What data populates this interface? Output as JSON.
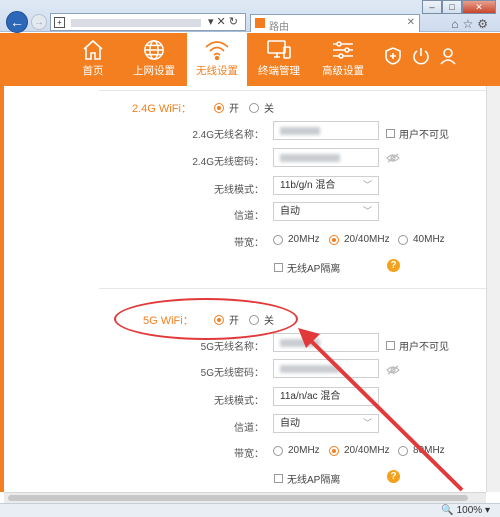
{
  "browser": {
    "tab_title": "路由",
    "zoom": "100%"
  },
  "nav": {
    "items": [
      {
        "label": "首页",
        "icon": "home-icon"
      },
      {
        "label": "上网设置",
        "icon": "globe-icon"
      },
      {
        "label": "无线设置",
        "icon": "wifi-icon"
      },
      {
        "label": "终端管理",
        "icon": "devices-icon"
      },
      {
        "label": "高级设置",
        "icon": "sliders-icon"
      }
    ],
    "active_index": 2
  },
  "wifi24": {
    "title": "2.4G WiFi：",
    "on_label": "开",
    "off_label": "关",
    "enabled": true,
    "name_label": "2.4G无线名称：",
    "hide_label": "用户不可见",
    "pwd_label": "2.4G无线密码：",
    "mode_label": "无线模式：",
    "mode_value": "11b/g/n 混合",
    "channel_label": "信道：",
    "channel_value": "自动",
    "bw_label": "带宽：",
    "bw_options": [
      "20MHz",
      "20/40MHz",
      "40MHz"
    ],
    "bw_selected": "20/40MHz",
    "ap_isolation_label": "无线AP隔离"
  },
  "wifi5": {
    "title": "5G WiFi：",
    "on_label": "开",
    "off_label": "关",
    "enabled": true,
    "name_label": "5G无线名称：",
    "hide_label": "用户不可见",
    "pwd_label": "5G无线密码：",
    "mode_label": "无线模式：",
    "mode_value": "11a/n/ac 混合",
    "channel_label": "信道：",
    "channel_value": "自动",
    "bw_label": "带宽：",
    "bw_options": [
      "20MHz",
      "20/40MHz",
      "80MHz"
    ],
    "bw_selected": "20/40MHz",
    "ap_isolation_label": "无线AP隔离"
  },
  "colors": {
    "accent": "#f47f20",
    "annotation": "#e23a3a"
  }
}
